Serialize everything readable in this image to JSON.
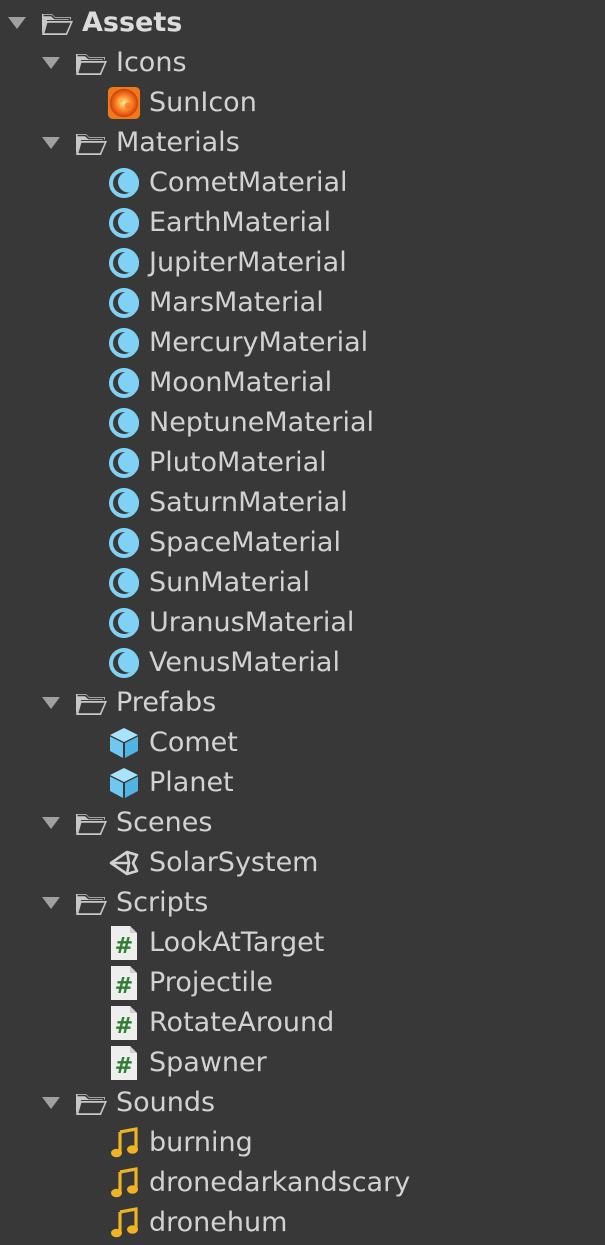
{
  "tree": [
    {
      "label": "Assets",
      "type": "folder",
      "depth": 0,
      "expanded": true,
      "icon": "folder-open-icon"
    },
    {
      "label": "Icons",
      "type": "folder",
      "depth": 1,
      "expanded": true,
      "icon": "folder-open-icon"
    },
    {
      "label": "SunIcon",
      "type": "texture",
      "depth": 2,
      "icon": "sun-texture-icon"
    },
    {
      "label": "Materials",
      "type": "folder",
      "depth": 1,
      "expanded": true,
      "icon": "folder-open-icon"
    },
    {
      "label": "CometMaterial",
      "type": "material",
      "depth": 2,
      "icon": "material-sphere-icon"
    },
    {
      "label": "EarthMaterial",
      "type": "material",
      "depth": 2,
      "icon": "material-sphere-icon"
    },
    {
      "label": "JupiterMaterial",
      "type": "material",
      "depth": 2,
      "icon": "material-sphere-icon"
    },
    {
      "label": "MarsMaterial",
      "type": "material",
      "depth": 2,
      "icon": "material-sphere-icon"
    },
    {
      "label": "MercuryMaterial",
      "type": "material",
      "depth": 2,
      "icon": "material-sphere-icon"
    },
    {
      "label": "MoonMaterial",
      "type": "material",
      "depth": 2,
      "icon": "material-sphere-icon"
    },
    {
      "label": "NeptuneMaterial",
      "type": "material",
      "depth": 2,
      "icon": "material-sphere-icon"
    },
    {
      "label": "PlutoMaterial",
      "type": "material",
      "depth": 2,
      "icon": "material-sphere-icon"
    },
    {
      "label": "SaturnMaterial",
      "type": "material",
      "depth": 2,
      "icon": "material-sphere-icon"
    },
    {
      "label": "SpaceMaterial",
      "type": "material",
      "depth": 2,
      "icon": "material-sphere-icon"
    },
    {
      "label": "SunMaterial",
      "type": "material",
      "depth": 2,
      "icon": "material-sphere-icon"
    },
    {
      "label": "UranusMaterial",
      "type": "material",
      "depth": 2,
      "icon": "material-sphere-icon"
    },
    {
      "label": "VenusMaterial",
      "type": "material",
      "depth": 2,
      "icon": "material-sphere-icon"
    },
    {
      "label": "Prefabs",
      "type": "folder",
      "depth": 1,
      "expanded": true,
      "icon": "folder-open-icon"
    },
    {
      "label": "Comet",
      "type": "prefab",
      "depth": 2,
      "icon": "prefab-cube-icon"
    },
    {
      "label": "Planet",
      "type": "prefab",
      "depth": 2,
      "icon": "prefab-cube-icon"
    },
    {
      "label": "Scenes",
      "type": "folder",
      "depth": 1,
      "expanded": true,
      "icon": "folder-open-icon"
    },
    {
      "label": "SolarSystem",
      "type": "scene",
      "depth": 2,
      "icon": "unity-scene-icon"
    },
    {
      "label": "Scripts",
      "type": "folder",
      "depth": 1,
      "expanded": true,
      "icon": "folder-open-icon"
    },
    {
      "label": "LookAtTarget",
      "type": "script",
      "depth": 2,
      "icon": "csharp-script-icon"
    },
    {
      "label": "Projectile",
      "type": "script",
      "depth": 2,
      "icon": "csharp-script-icon"
    },
    {
      "label": "RotateAround",
      "type": "script",
      "depth": 2,
      "icon": "csharp-script-icon"
    },
    {
      "label": "Spawner",
      "type": "script",
      "depth": 2,
      "icon": "csharp-script-icon"
    },
    {
      "label": "Sounds",
      "type": "folder",
      "depth": 1,
      "expanded": true,
      "icon": "folder-open-icon"
    },
    {
      "label": "burning",
      "type": "audio",
      "depth": 2,
      "icon": "audio-note-icon"
    },
    {
      "label": "dronedarkandscary",
      "type": "audio",
      "depth": 2,
      "icon": "audio-note-icon"
    },
    {
      "label": "dronehum",
      "type": "audio",
      "depth": 2,
      "icon": "audio-note-icon"
    }
  ],
  "colors": {
    "background": "#383838",
    "text": "#d2d2d2",
    "material": "#7fd1f5",
    "prefab": "#6fc8ef",
    "audio": "#f0b323",
    "script_hash": "#2e7d32"
  }
}
